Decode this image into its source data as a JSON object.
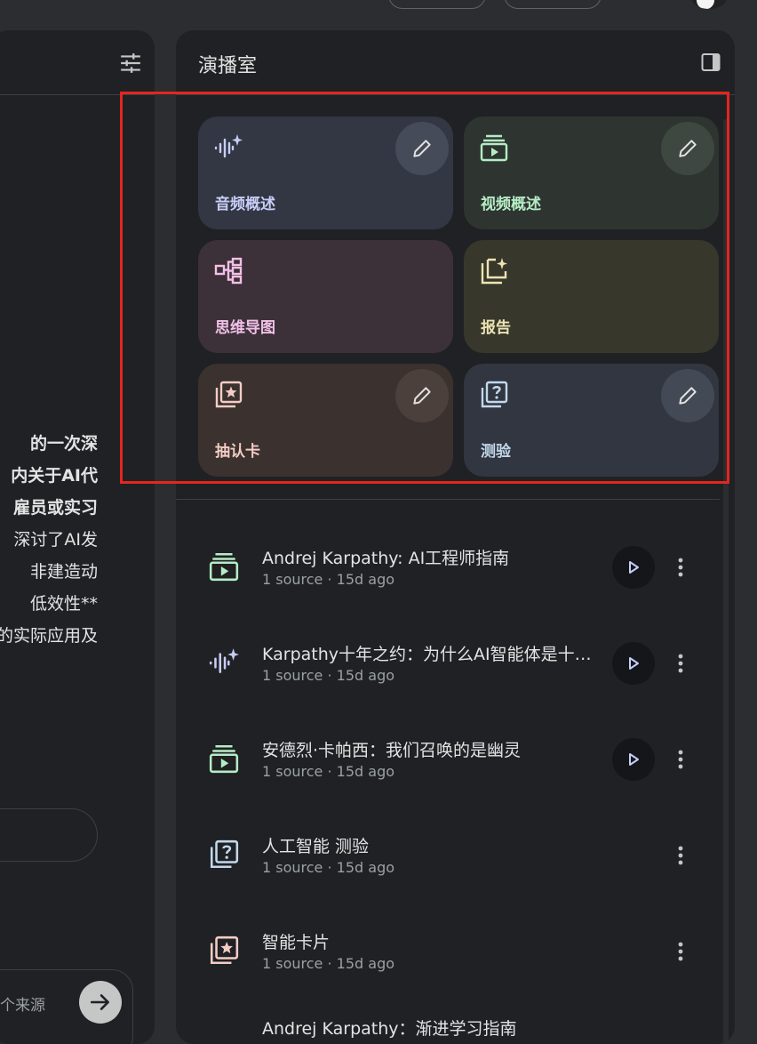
{
  "colors": {
    "accent_red": "#e5251f",
    "audio_tile_bg": "#333743",
    "audio_tile_fg": "#c7cdf7",
    "video_tile_bg": "#2e3530",
    "video_tile_fg": "#b6ecc5",
    "mindmap_tile_bg": "#3d3139",
    "mindmap_tile_fg": "#f1c0e7",
    "report_tile_bg": "#38372b",
    "report_tile_fg": "#ece4b4",
    "flashcard_tile_bg": "#3b312f",
    "flashcard_tile_fg": "#f3cdc4",
    "quiz_tile_bg": "#313640",
    "quiz_tile_fg": "#c2d8ec"
  },
  "chat": {
    "lines": [
      "的一次深",
      "内关于AI代",
      "雇员或实习",
      "深讨了AI发",
      "非建造动",
      "低效性**",
      "的实际应用及"
    ],
    "source_count": "个来源"
  },
  "studio": {
    "title": "演播室",
    "tiles": [
      {
        "label": "音频概述",
        "icon": "audio-sparkle-icon",
        "editable": true
      },
      {
        "label": "视频概述",
        "icon": "video-slides-icon",
        "editable": true
      },
      {
        "label": "思维导图",
        "icon": "mind-map-icon",
        "editable": false
      },
      {
        "label": "报告",
        "icon": "report-sparkle-icon",
        "editable": false
      },
      {
        "label": "抽认卡",
        "icon": "flashcards-icon",
        "editable": true
      },
      {
        "label": "测验",
        "icon": "quiz-icon",
        "editable": true
      }
    ],
    "items": [
      {
        "title": "Andrej Karpathy: AI工程师指南",
        "meta": "1 source · 15d ago",
        "icon": "video-slides-icon",
        "playable": true
      },
      {
        "title": "Karpathy十年之约：为什么AI智能体是十年而非一年的事",
        "meta": "1 source · 15d ago",
        "icon": "audio-sparkle-icon",
        "playable": true
      },
      {
        "title": "安德烈·卡帕西：我们召唤的是幽灵",
        "meta": "1 source · 15d ago",
        "icon": "video-slides-icon",
        "playable": true
      },
      {
        "title": "人工智能 测验",
        "meta": "1 source · 15d ago",
        "icon": "quiz-icon",
        "playable": false
      },
      {
        "title": "智能卡片",
        "meta": "1 source · 15d ago",
        "icon": "flashcards-icon",
        "playable": false
      }
    ],
    "partial_item_title": "Andrej Karpathy：渐进学习指南"
  }
}
